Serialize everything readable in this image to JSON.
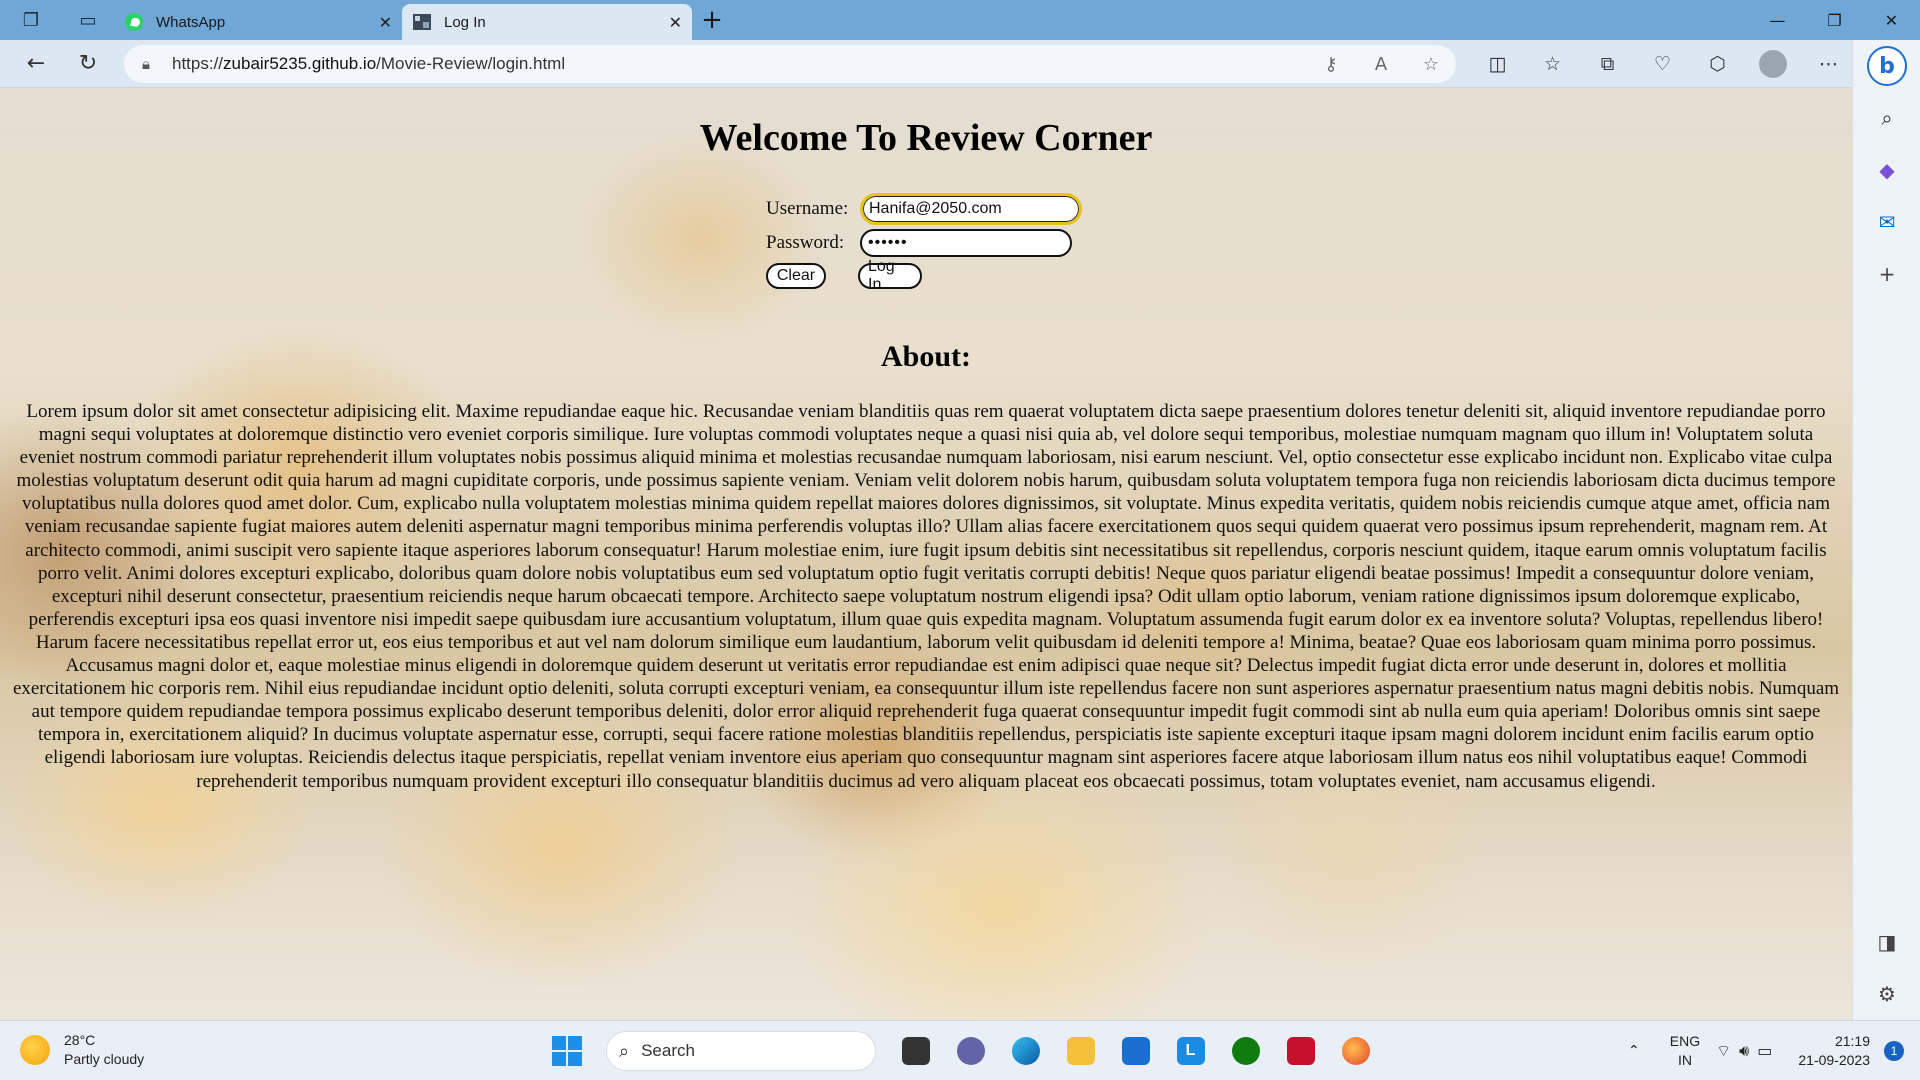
{
  "browser": {
    "tabs": [
      {
        "title": "WhatsApp",
        "active": false
      },
      {
        "title": "Log In",
        "active": true
      }
    ],
    "url": {
      "scheme": "https://",
      "host": "zubair5235.github.io",
      "path": "/Movie-Review/login.html"
    }
  },
  "page": {
    "title": "Welcome To Review Corner",
    "username_label": "Username:",
    "username_value": "Hanifa@2050.com",
    "password_label": "Password:",
    "password_mask": "••••••",
    "clear_label": "Clear",
    "login_label": "Log In",
    "about_title": "About:",
    "about_text": "Lorem ipsum dolor sit amet consectetur adipisicing elit. Maxime repudiandae eaque hic. Recusandae veniam blanditiis quas rem quaerat voluptatem dicta saepe praesentium dolores tenetur deleniti sit, aliquid inventore repudiandae porro magni sequi voluptates at doloremque distinctio vero eveniet corporis similique. Iure voluptas commodi voluptates neque a quasi nisi quia ab, vel dolore sequi temporibus, molestiae numquam magnam quo illum in! Voluptatem soluta eveniet nostrum commodi pariatur reprehenderit illum voluptates nobis possimus aliquid minima et molestias recusandae numquam laboriosam, nisi earum nesciunt. Vel, optio consectetur esse explicabo incidunt non. Explicabo vitae culpa molestias voluptatum deserunt odit quia harum ad magni cupiditate corporis, unde possimus sapiente veniam. Veniam velit dolorem nobis harum, quibusdam soluta voluptatem tempora fuga non reiciendis laboriosam dicta ducimus tempore voluptatibus nulla dolores quod amet dolor. Cum, explicabo nulla voluptatem molestias minima quidem repellat maiores dolores dignissimos, sit voluptate. Minus expedita veritatis, quidem nobis reiciendis cumque atque amet, officia nam veniam recusandae sapiente fugiat maiores autem deleniti aspernatur magni temporibus minima perferendis voluptas illo? Ullam alias facere exercitationem quos sequi quidem quaerat vero possimus ipsum reprehenderit, magnam rem. At architecto commodi, animi suscipit vero sapiente itaque asperiores laborum consequatur! Harum molestiae enim, iure fugit ipsum debitis sint necessitatibus sit repellendus, corporis nesciunt quidem, itaque earum omnis voluptatum facilis porro velit. Animi dolores excepturi explicabo, doloribus quam dolore nobis voluptatibus eum sed voluptatum optio fugit veritatis corrupti debitis! Neque quos pariatur eligendi beatae possimus! Impedit a consequuntur dolore veniam, excepturi nihil deserunt consectetur, praesentium reiciendis neque harum obcaecati tempore. Architecto saepe voluptatum nostrum eligendi ipsa? Odit ullam optio laborum, veniam ratione dignissimos ipsum doloremque explicabo, perferendis excepturi ipsa eos quasi inventore nisi impedit saepe quibusdam iure accusantium voluptatum, illum quae quis expedita magnam. Voluptatum assumenda fugit earum dolor ex ea inventore soluta? Voluptas, repellendus libero! Harum facere necessitatibus repellat error ut, eos eius temporibus et aut vel nam dolorum similique eum laudantium, laborum velit quibusdam id deleniti tempore a! Minima, beatae? Quae eos laboriosam quam minima porro possimus. Accusamus magni dolor et, eaque molestiae minus eligendi in doloremque quidem deserunt ut veritatis error repudiandae est enim adipisci quae neque sit? Delectus impedit fugiat dicta error unde deserunt in, dolores et mollitia exercitationem hic corporis rem. Nihil eius repudiandae incidunt optio deleniti, soluta corrupti excepturi veniam, ea consequuntur illum iste repellendus facere non sunt asperiores aspernatur praesentium natus magni debitis nobis. Numquam aut tempore quidem repudiandae tempora possimus explicabo deserunt temporibus deleniti, dolor error aliquid reprehenderit fuga quaerat consequuntur impedit fugit commodi sint ab nulla eum quia aperiam! Doloribus omnis sint saepe tempora in, exercitationem aliquid? In ducimus voluptate aspernatur esse, corrupti, sequi facere ratione molestias blanditiis repellendus, perspiciatis iste sapiente excepturi itaque ipsam magni dolorem incidunt enim facilis earum optio eligendi laboriosam iure voluptas. Reiciendis delectus itaque perspiciatis, repellat veniam inventore eius aperiam quo consequuntur magnam sint asperiores facere atque laboriosam illum natus eos nihil voluptatibus eaque! Commodi reprehenderit temporibus numquam provident excepturi illo consequatur blanditiis ducimus ad vero aliquam placeat eos obcaecati possimus, totam voluptates eveniet, nam accusamus eligendi."
  },
  "taskbar": {
    "weather_temp": "28°C",
    "weather_desc": "Partly cloudy",
    "search_placeholder": "Search",
    "lang_line1": "ENG",
    "lang_line2": "IN",
    "time": "21:19",
    "date": "21-09-2023",
    "notification_count": "1"
  },
  "colors": {
    "tabbar": "#6fa7d6",
    "navbar": "#dbe8f4",
    "username_focus_ring": "#e8c418"
  }
}
